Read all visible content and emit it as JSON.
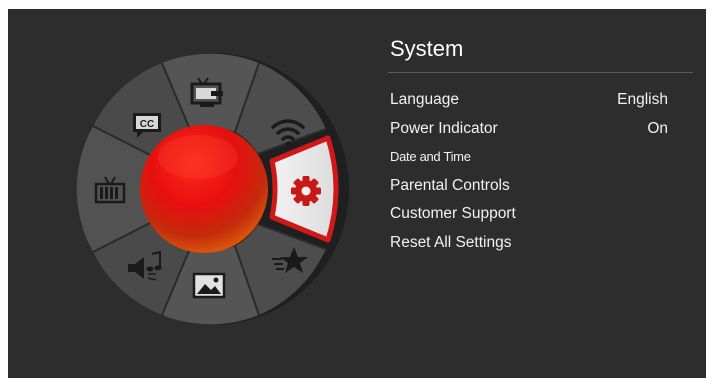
{
  "panel": {
    "title": "System",
    "items": [
      {
        "label": "Language",
        "value": "English"
      },
      {
        "label": "Power Indicator",
        "value": "On"
      },
      {
        "label": "Date and Time",
        "value": ""
      },
      {
        "label": "Parental Controls",
        "value": ""
      },
      {
        "label": "Customer Support",
        "value": ""
      },
      {
        "label": "Reset All Settings",
        "value": ""
      }
    ]
  },
  "wheel": {
    "selected_segment": "system-settings",
    "segments": [
      {
        "icon": "tv-input-icon"
      },
      {
        "icon": "wifi-icon"
      },
      {
        "icon": "gear-icon"
      },
      {
        "icon": "star-icon"
      },
      {
        "icon": "picture-icon"
      },
      {
        "icon": "audio-icon"
      },
      {
        "icon": "tv-channels-icon"
      },
      {
        "icon": "closed-caption-icon"
      }
    ],
    "closed_caption_text": "CC"
  },
  "colors": {
    "background": "#2d2d2d",
    "accent": "#d01818",
    "text": "#f2f2f2"
  }
}
